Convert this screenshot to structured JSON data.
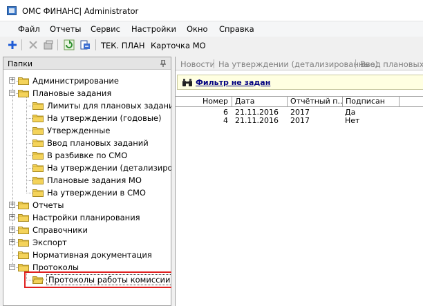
{
  "window": {
    "title": "ОМС ФИНАНС| Administrator"
  },
  "menu": [
    "Файл",
    "Отчеты",
    "Сервис",
    "Настройки",
    "Окно",
    "Справка"
  ],
  "toolbar": {
    "tek_plan": "ТЕК. ПЛАН",
    "kartochka_mo": "Карточка МО"
  },
  "left_panel": {
    "title": "Папки",
    "tree": [
      {
        "label": "Администрирование",
        "level": 0,
        "expander": "+"
      },
      {
        "label": "Плановые задания",
        "level": 0,
        "expander": "-"
      },
      {
        "label": "Лимиты для плановых заданий",
        "level": 1
      },
      {
        "label": "На утверждении (годовые)",
        "level": 1
      },
      {
        "label": "Утвержденные",
        "level": 1
      },
      {
        "label": "Ввод плановых заданий",
        "level": 1
      },
      {
        "label": "В разбивке по СМО",
        "level": 1
      },
      {
        "label": "На утверждении (детализирован",
        "level": 1
      },
      {
        "label": "Плановые задания МО",
        "level": 1
      },
      {
        "label": "На утверждении в СМО",
        "level": 1
      },
      {
        "label": "Отчеты",
        "level": 0,
        "expander": "+"
      },
      {
        "label": "Настройки планирования",
        "level": 0,
        "expander": "+"
      },
      {
        "label": "Справочники",
        "level": 0,
        "expander": "+"
      },
      {
        "label": "Экспорт",
        "level": 0,
        "expander": "+"
      },
      {
        "label": "Нормативная документация",
        "level": 0
      },
      {
        "label": "Протоколы",
        "level": 0,
        "expander": "-"
      },
      {
        "label": "Протоколы работы комиссии",
        "level": 1,
        "selected": true,
        "open": true
      }
    ]
  },
  "right_panel": {
    "tabs": [
      "Новости",
      "На утверждении (детализированные)",
      "Ввод плановых за"
    ],
    "filter_text": "Фильтр не задан",
    "columns": [
      "Номер",
      "Дата",
      "Отчётный п...",
      "Подписан"
    ],
    "rows": [
      [
        "6",
        "21.11.2016",
        "2017",
        "Да"
      ],
      [
        "4",
        "21.11.2016",
        "2017",
        "Нет"
      ]
    ]
  },
  "colors": {
    "highlight": "#e0201f",
    "filter_bg": "#ffffe1",
    "folder": "#f4d35a"
  }
}
